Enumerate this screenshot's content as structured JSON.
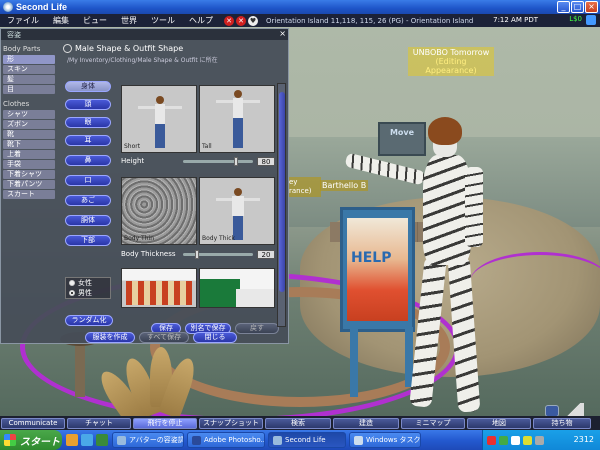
{
  "window": {
    "title": "Second Life"
  },
  "menu": [
    "ファイル",
    "編集",
    "ビュー",
    "世界",
    "ツール",
    "ヘルプ"
  ],
  "status": {
    "location": "Orientation Island 11,118, 115, 26 (PG) - Orientation Island",
    "time": "7:12 AM PDT",
    "money": "L$0"
  },
  "scene": {
    "avatar_name_line1": "UNBOBO Tomorrow",
    "avatar_name_line2": "(Editing Appearance)",
    "other_avatar": "Barthello B",
    "label_partial_1": "ey",
    "label_partial_2": "rance)",
    "sign_text": "Move"
  },
  "panel": {
    "title": "容姿",
    "close": "×",
    "body_parts_header": "Body Parts",
    "body_parts": [
      "形",
      "スキン",
      "髪",
      "目"
    ],
    "clothes_header": "Clothes",
    "clothes": [
      "シャツ",
      "ズボン",
      "靴",
      "靴下",
      "上着",
      "手袋",
      "下着シャツ",
      "下着パンツ",
      "スカート"
    ],
    "shape_title": "Male Shape & Outfit Shape",
    "shape_path": "/My Inventory/Clothing/Male Shape & Outfit に所在",
    "params": [
      "身体",
      "頭",
      "眼",
      "耳",
      "鼻",
      "口",
      "あご",
      "胴体",
      "下部"
    ],
    "previews": {
      "p1": "Short",
      "p2": "Tall",
      "p3": "Body Thin",
      "p4": "Body Thick"
    },
    "sliders": {
      "height_label": "Height",
      "height_value": "80",
      "thickness_label": "Body Thickness",
      "thickness_value": "20"
    },
    "gender": {
      "female": "女性",
      "male": "男性",
      "selected": "male"
    },
    "random_button": "ランダム化",
    "save_button": "保存",
    "save_as_button": "別名で保存",
    "revert_button": "戻す",
    "make_outfit_button": "服装を作成",
    "save_all_button": "すべて保存",
    "close_button": "閉じる"
  },
  "toolbar": [
    "Communicate",
    "チャット",
    "飛行を停止",
    "スナップショット",
    "検索",
    "建造",
    "ミニマップ",
    "地図",
    "持ち物"
  ],
  "taskbar": {
    "start": "スタート",
    "tasks": [
      "アバターの容姿調...",
      "Adobe Photosho...",
      "Second Life",
      "Windows タスク..."
    ],
    "clock": "2312"
  },
  "colors": {
    "panel_bg": "#464e58",
    "accent_button": "#3a46c0",
    "titlebar": "#2a62d8",
    "selection_ring": "#b030d0"
  }
}
